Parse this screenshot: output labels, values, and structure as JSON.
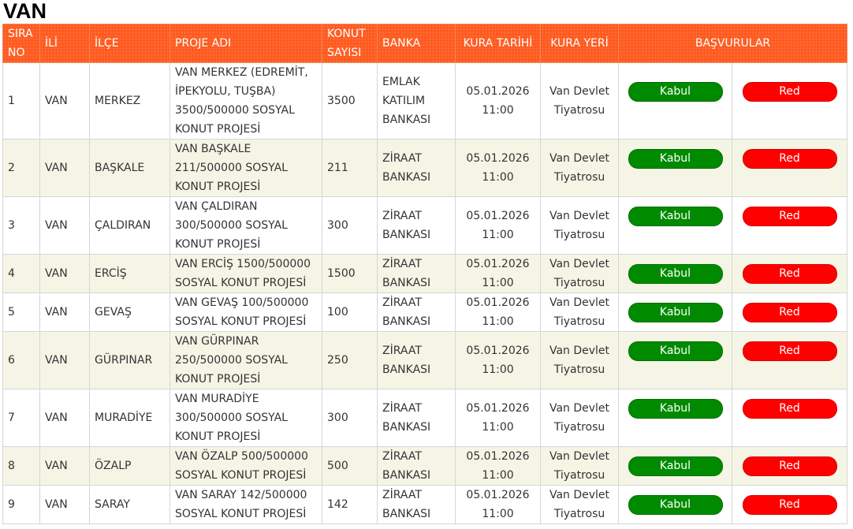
{
  "page": {
    "title": "VAN"
  },
  "colors": {
    "header": "#ff5a1f",
    "kabul": "#008a00",
    "red": "#ff0000",
    "stripe": "#f5f5e6"
  },
  "table": {
    "headers": {
      "sira": "SIRA NO",
      "ili": "İLİ",
      "ilce": "İLÇE",
      "proje": "PROJE ADI",
      "konut": "KONUT SAYISI",
      "banka": "BANKA",
      "tarih": "KURA TARİHİ",
      "yer": "KURA YERİ",
      "basvurular": "BAŞVURULAR"
    },
    "rows": [
      {
        "sira": "1",
        "ili": "VAN",
        "ilce": "MERKEZ",
        "proje": "VAN MERKEZ (EDREMİT, İPEKYOLU, TUŞBA) 3500/500000 SOSYAL KONUT PROJESİ",
        "konut": "3500",
        "banka": "EMLAK KATILIM BANKASI",
        "tarih": "05.01.2026 11:00",
        "yer": "Van Devlet Tiyatrosu",
        "kabul": "Kabul",
        "red": "Red"
      },
      {
        "sira": "2",
        "ili": "VAN",
        "ilce": "BAŞKALE",
        "proje": "VAN BAŞKALE 211/500000 SOSYAL KONUT PROJESİ",
        "konut": "211",
        "banka": "ZİRAAT BANKASI",
        "tarih": "05.01.2026 11:00",
        "yer": "Van Devlet Tiyatrosu",
        "kabul": "Kabul",
        "red": "Red"
      },
      {
        "sira": "3",
        "ili": "VAN",
        "ilce": "ÇALDIRAN",
        "proje": "VAN ÇALDIRAN 300/500000 SOSYAL KONUT PROJESİ",
        "konut": "300",
        "banka": "ZİRAAT BANKASI",
        "tarih": "05.01.2026 11:00",
        "yer": "Van Devlet Tiyatrosu",
        "kabul": "Kabul",
        "red": "Red"
      },
      {
        "sira": "4",
        "ili": "VAN",
        "ilce": "ERCİŞ",
        "proje": "VAN ERCİŞ 1500/500000 SOSYAL KONUT PROJESİ",
        "konut": "1500",
        "banka": "ZİRAAT BANKASI",
        "tarih": "05.01.2026 11:00",
        "yer": "Van Devlet Tiyatrosu",
        "kabul": "Kabul",
        "red": "Red"
      },
      {
        "sira": "5",
        "ili": "VAN",
        "ilce": "GEVAŞ",
        "proje": "VAN GEVAŞ 100/500000 SOSYAL KONUT PROJESİ",
        "konut": "100",
        "banka": "ZİRAAT BANKASI",
        "tarih": "05.01.2026 11:00",
        "yer": "Van Devlet Tiyatrosu",
        "kabul": "Kabul",
        "red": "Red"
      },
      {
        "sira": "6",
        "ili": "VAN",
        "ilce": "GÜRPINAR",
        "proje": "VAN GÜRPINAR 250/500000 SOSYAL KONUT PROJESİ",
        "konut": "250",
        "banka": "ZİRAAT BANKASI",
        "tarih": "05.01.2026 11:00",
        "yer": "Van Devlet Tiyatrosu",
        "kabul": "Kabul",
        "red": "Red"
      },
      {
        "sira": "7",
        "ili": "VAN",
        "ilce": "MURADİYE",
        "proje": "VAN MURADİYE 300/500000 SOSYAL KONUT PROJESİ",
        "konut": "300",
        "banka": "ZİRAAT BANKASI",
        "tarih": "05.01.2026 11:00",
        "yer": "Van Devlet Tiyatrosu",
        "kabul": "Kabul",
        "red": "Red"
      },
      {
        "sira": "8",
        "ili": "VAN",
        "ilce": "ÖZALP",
        "proje": "VAN ÖZALP 500/500000 SOSYAL KONUT PROJESİ",
        "konut": "500",
        "banka": "ZİRAAT BANKASI",
        "tarih": "05.01.2026 11:00",
        "yer": "Van Devlet Tiyatrosu",
        "kabul": "Kabul",
        "red": "Red"
      },
      {
        "sira": "9",
        "ili": "VAN",
        "ilce": "SARAY",
        "proje": "VAN SARAY 142/500000 SOSYAL KONUT PROJESİ",
        "konut": "142",
        "banka": "ZİRAAT BANKASI",
        "tarih": "05.01.2026 11:00",
        "yer": "Van Devlet Tiyatrosu",
        "kabul": "Kabul",
        "red": "Red"
      }
    ]
  }
}
